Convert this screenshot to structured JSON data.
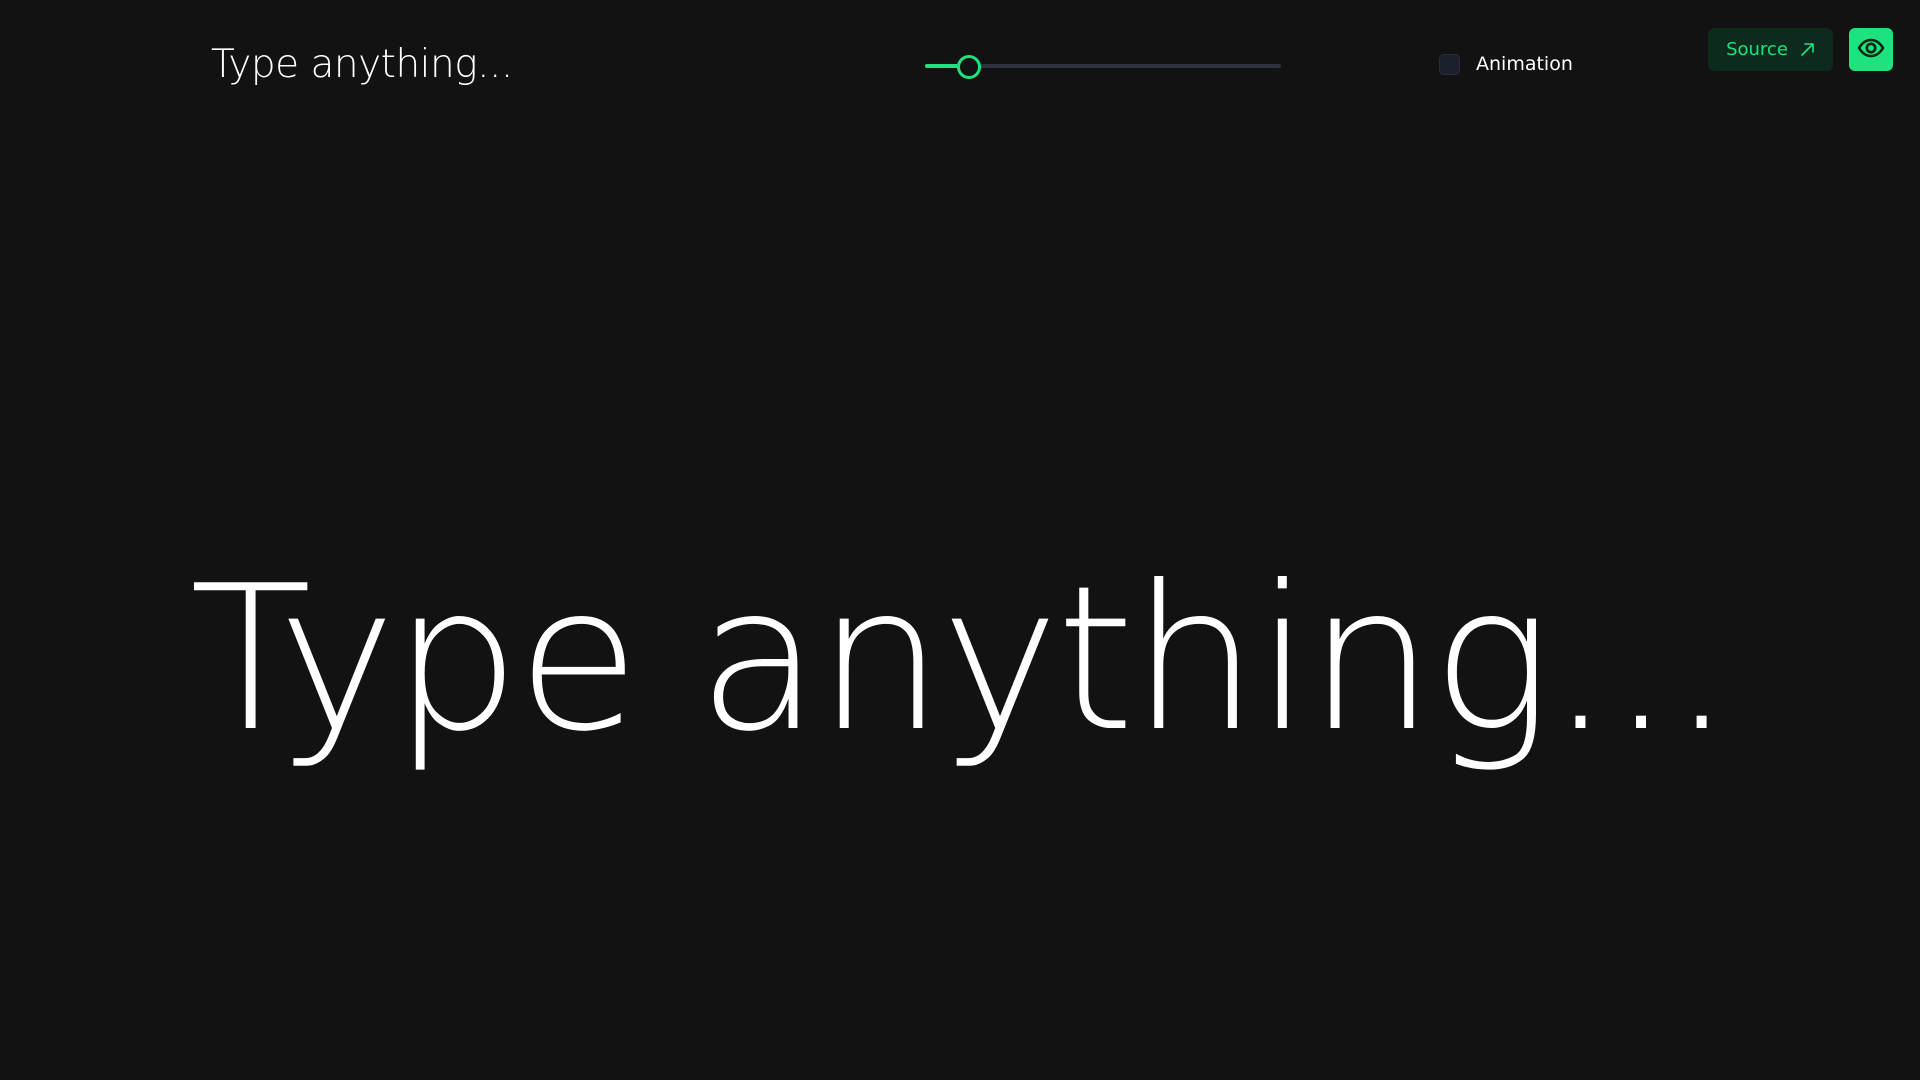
{
  "input": {
    "value": "Type anything..."
  },
  "slider": {
    "level": 0.12,
    "accent_color": "#1de27d",
    "track_color": "#2e3140"
  },
  "animation_toggle": {
    "label": "Animation",
    "checked": false
  },
  "source_button": {
    "label": "Source",
    "icon": "arrow-up-right-icon"
  },
  "eye_button": {
    "icon": "eye-icon"
  },
  "preview": {
    "text": "Type anything..."
  },
  "colors": {
    "background": "#121212",
    "accent": "#1de27d",
    "source_button_bg": "#0d2b1d"
  }
}
